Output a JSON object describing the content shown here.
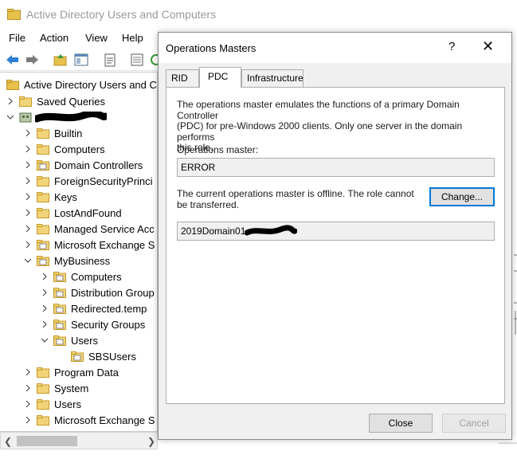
{
  "window": {
    "title": "Active Directory Users and Computers"
  },
  "menu": [
    "File",
    "Action",
    "View",
    "Help"
  ],
  "tree": {
    "root_label": "Active Directory Users and C",
    "items": [
      {
        "label": "Saved Queries"
      },
      {
        "label": ""
      },
      {
        "label": "Builtin"
      },
      {
        "label": "Computers"
      },
      {
        "label": "Domain Controllers"
      },
      {
        "label": "ForeignSecurityPrinci"
      },
      {
        "label": "Keys"
      },
      {
        "label": "LostAndFound"
      },
      {
        "label": "Managed Service Acc"
      },
      {
        "label": "Microsoft Exchange S"
      },
      {
        "label": "MyBusiness"
      },
      {
        "label": "Computers"
      },
      {
        "label": "Distribution Group"
      },
      {
        "label": "Redirected.temp"
      },
      {
        "label": "Security Groups"
      },
      {
        "label": "Users"
      },
      {
        "label": "SBSUsers"
      },
      {
        "label": "Program Data"
      },
      {
        "label": "System"
      },
      {
        "label": "Users"
      },
      {
        "label": "Microsoft Exchange S"
      }
    ]
  },
  "dialog": {
    "title": "Operations Masters",
    "help_glyph": "?",
    "close_glyph": "✕",
    "tabs": [
      "RID",
      "PDC",
      "Infrastructure"
    ],
    "active_tab": "PDC",
    "description_lines": [
      "The operations master emulates the functions of a primary Domain Controller",
      "(PDC) for pre-Windows 2000 clients. Only one server in the domain performs",
      "this role."
    ],
    "operations_master_label": "Operations master:",
    "operations_master_value": "ERROR",
    "status_lines": [
      "The current operations master is offline. The role cannot",
      "be transferred."
    ],
    "change_label": "Change...",
    "target_value": "2019Domain01",
    "close_label": "Close",
    "cancel_label": "Cancel"
  },
  "colors": {
    "accent": "#0078d7",
    "folder": "#e8c14a",
    "folder_dark": "#c79a23"
  }
}
